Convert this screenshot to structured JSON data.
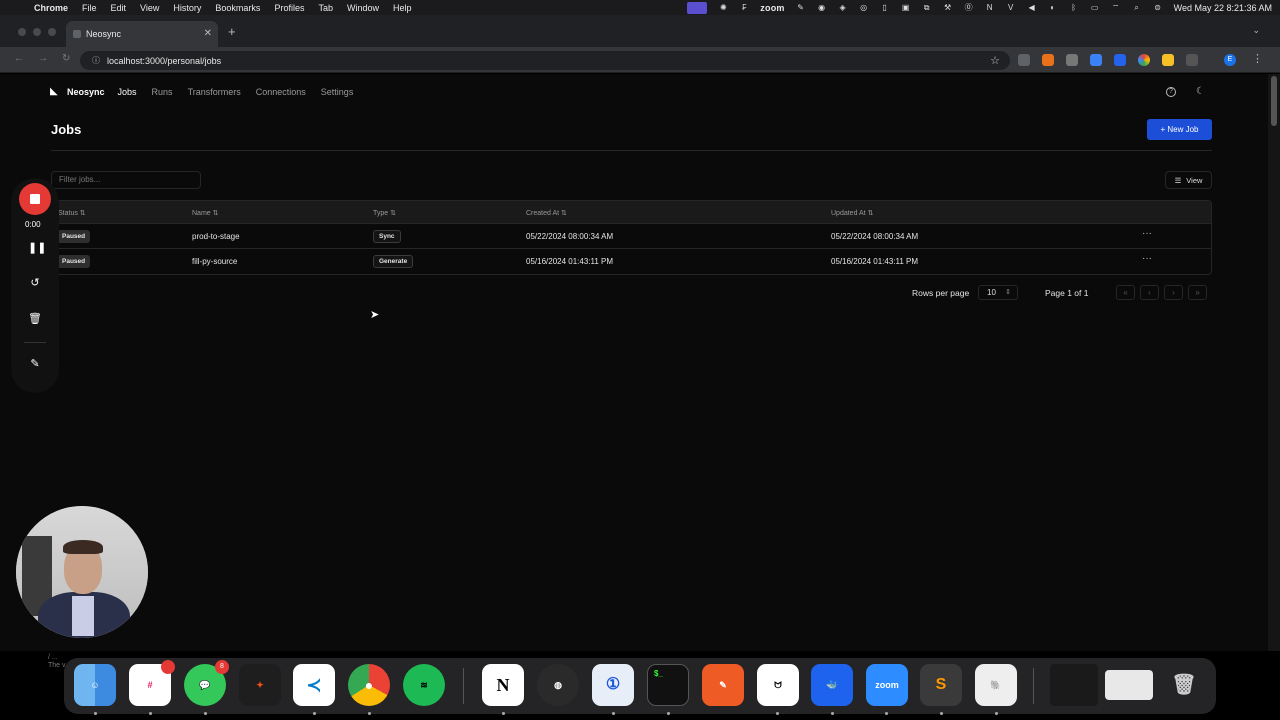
{
  "menubar": {
    "items": [
      "Chrome",
      "File",
      "Edit",
      "View",
      "History",
      "Bookmarks",
      "Profiles",
      "Tab",
      "Window",
      "Help"
    ],
    "zoom_label": "zoom",
    "clock": "Wed May 22  8:21:36 AM"
  },
  "browser": {
    "tab_title": "Neosync",
    "url": "localhost:3000/personal/jobs",
    "profile_initial": "E"
  },
  "app": {
    "brand": "Neosync",
    "nav": [
      "Jobs",
      "Runs",
      "Transformers",
      "Connections",
      "Settings"
    ],
    "page_title": "Jobs",
    "new_job_label": "+ New Job",
    "filter_placeholder": "Filter jobs...",
    "view_label": "View",
    "table": {
      "headers": [
        "Status",
        "Name",
        "Type",
        "Created At",
        "Updated At"
      ],
      "rows": [
        {
          "status": "Paused",
          "name": "prod-to-stage",
          "type": "Sync",
          "created": "05/22/2024 08:00:34 AM",
          "updated": "05/22/2024 08:00:34 AM",
          "more": "···"
        },
        {
          "status": "Paused",
          "name": "fill-py-source",
          "type": "Generate",
          "created": "05/16/2024 01:43:11 PM",
          "updated": "05/16/2024 01:43:11 PM",
          "more": "···"
        }
      ]
    },
    "pagination": {
      "rows_per_page_label": "Rows per page",
      "rows_per_page": "10",
      "page_info": "Page 1 of 1"
    }
  },
  "recorder": {
    "time": "0:00"
  },
  "dock": {
    "zoom_label": "zoom",
    "slack_badge": "",
    "messages_badge": "8",
    "bottom_text_1": "/ ...",
    "bottom_text_2": "The v"
  }
}
